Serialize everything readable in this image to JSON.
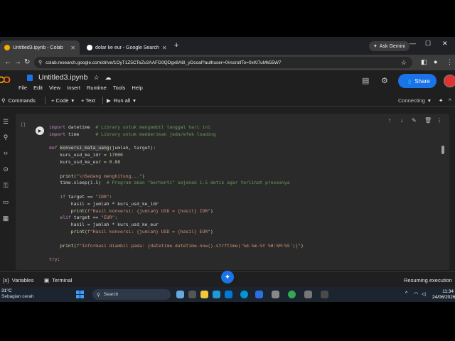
{
  "browser": {
    "tabs": [
      {
        "title": "Untitled3.ipynb - Colab",
        "active": true
      },
      {
        "title": "dolar ke eur - Google Search",
        "active": false
      }
    ],
    "new_tab": "+",
    "ask_gemini": "Ask Gemini",
    "url": "colab.research.google.com/drive/1OyT1Z5CTeZv2AAFG0QDgx8A8I_yDcoal?authuser=0#scrollTo=0xKl7uMk55W7"
  },
  "colab": {
    "notebook_title": "Untitled3.ipynb",
    "menu": [
      "File",
      "Edit",
      "View",
      "Insert",
      "Runtime",
      "Tools",
      "Help"
    ],
    "share_label": "Share",
    "toolbar": {
      "commands": "Commands",
      "code": "+ Code",
      "text": "+ Text",
      "run_all": "Run all",
      "connecting": "Connecting"
    },
    "cell_gutter": "[ ]",
    "code_lines": [
      "import datetime  # Library untuk mengambil tanggal hari ini",
      "import time      # Library untuk memberikan jeda/efek loading",
      "",
      "def konversi_mata_uang(jumlah, target):",
      "    kurs_usd_ke_idr = 17000",
      "    kurs_usd_ke_eur = 0.88",
      "",
      "    print(\"\\nSedang menghitung...\")",
      "    time.sleep(1.5)  # Program akan \"berhenti\" sejenak 1.5 detik agar terlihat prosesnya",
      "",
      "    if target == \"IDR\":",
      "        hasil = jumlah * kurs_usd_ke_idr",
      "        print(f\"Hasil konversi: {jumlah} USD = {hasil} IDR\")",
      "    elif target == \"EUR\":",
      "        hasil = jumlah * kurs_usd_ke_eur",
      "        print(f\"Hasil konversi: {jumlah} USD = {hasil} EUR\")",
      "",
      "    print(f\"Informasi diambil pada: {datetime.datetime.now().strftime('%d-%m-%Y %H:%M:%S')}\")",
      "",
      "try:"
    ],
    "status": {
      "variables": "Variables",
      "terminal": "Terminal",
      "resuming": "Resuming execution"
    }
  },
  "taskbar": {
    "temperature": "31°C",
    "weather_desc": "Sebagian cerah",
    "search_placeholder": "Search",
    "time": "11:34",
    "date": "24/06/2026"
  },
  "colors": {
    "accent": "#1a73e8",
    "background": "#1f1f1f",
    "cell": "#2a2a2a"
  }
}
